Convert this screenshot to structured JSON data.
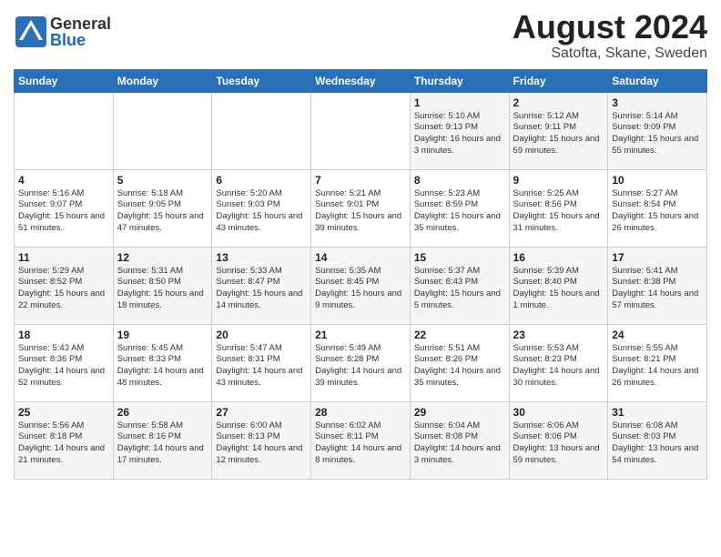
{
  "header": {
    "logo_general": "General",
    "logo_blue": "Blue",
    "title": "August 2024",
    "subtitle": "Satofta, Skane, Sweden"
  },
  "weekdays": [
    "Sunday",
    "Monday",
    "Tuesday",
    "Wednesday",
    "Thursday",
    "Friday",
    "Saturday"
  ],
  "weeks": [
    [
      {
        "day": "",
        "info": ""
      },
      {
        "day": "",
        "info": ""
      },
      {
        "day": "",
        "info": ""
      },
      {
        "day": "",
        "info": ""
      },
      {
        "day": "1",
        "info": "Sunrise: 5:10 AM\nSunset: 9:13 PM\nDaylight: 16 hours\nand 3 minutes."
      },
      {
        "day": "2",
        "info": "Sunrise: 5:12 AM\nSunset: 9:11 PM\nDaylight: 15 hours\nand 59 minutes."
      },
      {
        "day": "3",
        "info": "Sunrise: 5:14 AM\nSunset: 9:09 PM\nDaylight: 15 hours\nand 55 minutes."
      }
    ],
    [
      {
        "day": "4",
        "info": "Sunrise: 5:16 AM\nSunset: 9:07 PM\nDaylight: 15 hours\nand 51 minutes."
      },
      {
        "day": "5",
        "info": "Sunrise: 5:18 AM\nSunset: 9:05 PM\nDaylight: 15 hours\nand 47 minutes."
      },
      {
        "day": "6",
        "info": "Sunrise: 5:20 AM\nSunset: 9:03 PM\nDaylight: 15 hours\nand 43 minutes."
      },
      {
        "day": "7",
        "info": "Sunrise: 5:21 AM\nSunset: 9:01 PM\nDaylight: 15 hours\nand 39 minutes."
      },
      {
        "day": "8",
        "info": "Sunrise: 5:23 AM\nSunset: 8:59 PM\nDaylight: 15 hours\nand 35 minutes."
      },
      {
        "day": "9",
        "info": "Sunrise: 5:25 AM\nSunset: 8:56 PM\nDaylight: 15 hours\nand 31 minutes."
      },
      {
        "day": "10",
        "info": "Sunrise: 5:27 AM\nSunset: 8:54 PM\nDaylight: 15 hours\nand 26 minutes."
      }
    ],
    [
      {
        "day": "11",
        "info": "Sunrise: 5:29 AM\nSunset: 8:52 PM\nDaylight: 15 hours\nand 22 minutes."
      },
      {
        "day": "12",
        "info": "Sunrise: 5:31 AM\nSunset: 8:50 PM\nDaylight: 15 hours\nand 18 minutes."
      },
      {
        "day": "13",
        "info": "Sunrise: 5:33 AM\nSunset: 8:47 PM\nDaylight: 15 hours\nand 14 minutes."
      },
      {
        "day": "14",
        "info": "Sunrise: 5:35 AM\nSunset: 8:45 PM\nDaylight: 15 hours\nand 9 minutes."
      },
      {
        "day": "15",
        "info": "Sunrise: 5:37 AM\nSunset: 8:43 PM\nDaylight: 15 hours\nand 5 minutes."
      },
      {
        "day": "16",
        "info": "Sunrise: 5:39 AM\nSunset: 8:40 PM\nDaylight: 15 hours\nand 1 minute."
      },
      {
        "day": "17",
        "info": "Sunrise: 5:41 AM\nSunset: 8:38 PM\nDaylight: 14 hours\nand 57 minutes."
      }
    ],
    [
      {
        "day": "18",
        "info": "Sunrise: 5:43 AM\nSunset: 8:36 PM\nDaylight: 14 hours\nand 52 minutes."
      },
      {
        "day": "19",
        "info": "Sunrise: 5:45 AM\nSunset: 8:33 PM\nDaylight: 14 hours\nand 48 minutes."
      },
      {
        "day": "20",
        "info": "Sunrise: 5:47 AM\nSunset: 8:31 PM\nDaylight: 14 hours\nand 43 minutes."
      },
      {
        "day": "21",
        "info": "Sunrise: 5:49 AM\nSunset: 8:28 PM\nDaylight: 14 hours\nand 39 minutes."
      },
      {
        "day": "22",
        "info": "Sunrise: 5:51 AM\nSunset: 8:26 PM\nDaylight: 14 hours\nand 35 minutes."
      },
      {
        "day": "23",
        "info": "Sunrise: 5:53 AM\nSunset: 8:23 PM\nDaylight: 14 hours\nand 30 minutes."
      },
      {
        "day": "24",
        "info": "Sunrise: 5:55 AM\nSunset: 8:21 PM\nDaylight: 14 hours\nand 26 minutes."
      }
    ],
    [
      {
        "day": "25",
        "info": "Sunrise: 5:56 AM\nSunset: 8:18 PM\nDaylight: 14 hours\nand 21 minutes."
      },
      {
        "day": "26",
        "info": "Sunrise: 5:58 AM\nSunset: 8:16 PM\nDaylight: 14 hours\nand 17 minutes."
      },
      {
        "day": "27",
        "info": "Sunrise: 6:00 AM\nSunset: 8:13 PM\nDaylight: 14 hours\nand 12 minutes."
      },
      {
        "day": "28",
        "info": "Sunrise: 6:02 AM\nSunset: 8:11 PM\nDaylight: 14 hours\nand 8 minutes."
      },
      {
        "day": "29",
        "info": "Sunrise: 6:04 AM\nSunset: 8:08 PM\nDaylight: 14 hours\nand 3 minutes."
      },
      {
        "day": "30",
        "info": "Sunrise: 6:06 AM\nSunset: 8:06 PM\nDaylight: 13 hours\nand 59 minutes."
      },
      {
        "day": "31",
        "info": "Sunrise: 6:08 AM\nSunset: 8:03 PM\nDaylight: 13 hours\nand 54 minutes."
      }
    ]
  ]
}
